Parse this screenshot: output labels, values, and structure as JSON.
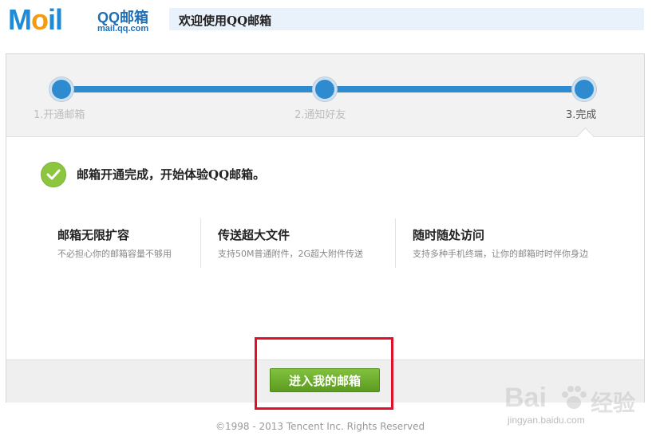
{
  "header": {
    "logo_text": "Mail",
    "brand": "QQ邮箱",
    "domain": "mail.qq.com",
    "welcome": "欢迎使用QQ邮箱"
  },
  "steps": [
    {
      "label": "1.开通邮箱",
      "state": "done"
    },
    {
      "label": "2.通知好友",
      "state": "done"
    },
    {
      "label": "3.完成",
      "state": "current"
    }
  ],
  "status": {
    "icon": "checkmark-circle-icon",
    "message": "邮箱开通完成，开始体验QQ邮箱。"
  },
  "features": [
    {
      "title": "邮箱无限扩容",
      "desc": "不必担心你的邮箱容量不够用"
    },
    {
      "title": "传送超大文件",
      "desc": "支持50M普通附件，2G超大附件传送"
    },
    {
      "title": "随时随处访问",
      "desc": "支持多种手机终端，让你的邮箱时时伴你身边"
    }
  ],
  "actions": {
    "enter_label": "进入我的邮箱"
  },
  "footer": {
    "copyright": "©1998 - 2013 Tencent Inc. Rights Reserved"
  },
  "watermark": {
    "brand": "Baidu经验",
    "url": "jingyan.baidu.com"
  },
  "colors": {
    "progress": "#2f8bd0",
    "button": "#6aab2a",
    "highlight": "#e0102a",
    "check": "#8cc63f"
  }
}
